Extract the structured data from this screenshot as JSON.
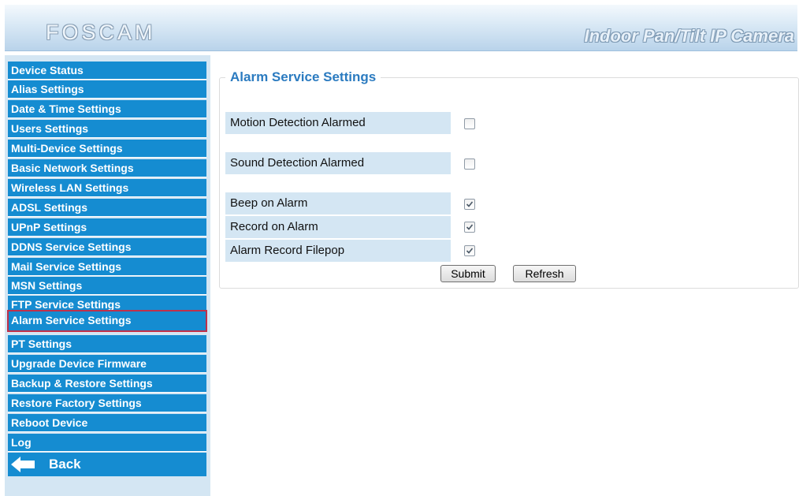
{
  "header": {
    "logo": "FOSCAM",
    "product": "Indoor Pan/Tilt IP Camera"
  },
  "sidebar": {
    "items": [
      {
        "label": "Device Status"
      },
      {
        "label": "Alias Settings"
      },
      {
        "label": "Date & Time Settings"
      },
      {
        "label": "Users Settings"
      },
      {
        "label": "Multi-Device Settings"
      },
      {
        "label": "Basic Network Settings"
      },
      {
        "label": "Wireless LAN Settings"
      },
      {
        "label": "ADSL Settings"
      },
      {
        "label": "UPnP Settings"
      },
      {
        "label": "DDNS Service Settings"
      },
      {
        "label": "Mail Service Settings"
      },
      {
        "label": "MSN Settings"
      },
      {
        "label": "FTP Service Settings"
      },
      {
        "label": "Alarm Service Settings",
        "active": true
      },
      {
        "label": "PT Settings"
      },
      {
        "label": "Upgrade Device Firmware"
      },
      {
        "label": "Backup & Restore Settings"
      },
      {
        "label": "Restore Factory Settings"
      },
      {
        "label": "Reboot Device"
      },
      {
        "label": "Log"
      }
    ],
    "back_label": "Back"
  },
  "main": {
    "section_title": "Alarm Service Settings",
    "fields": [
      {
        "label": "Motion Detection Alarmed",
        "checked": false
      },
      {
        "label": "Sound Detection Alarmed",
        "checked": false
      },
      {
        "label": "Beep on Alarm",
        "checked": true
      },
      {
        "label": "Record on Alarm",
        "checked": true
      },
      {
        "label": "Alarm Record Filepop",
        "checked": true
      }
    ],
    "submit_label": "Submit",
    "refresh_label": "Refresh"
  },
  "colors": {
    "nav_bg": "#158cd1",
    "sidebar_bg": "#d4e6f3",
    "active_outline": "#c0304a",
    "title_color": "#2b7bc0"
  }
}
